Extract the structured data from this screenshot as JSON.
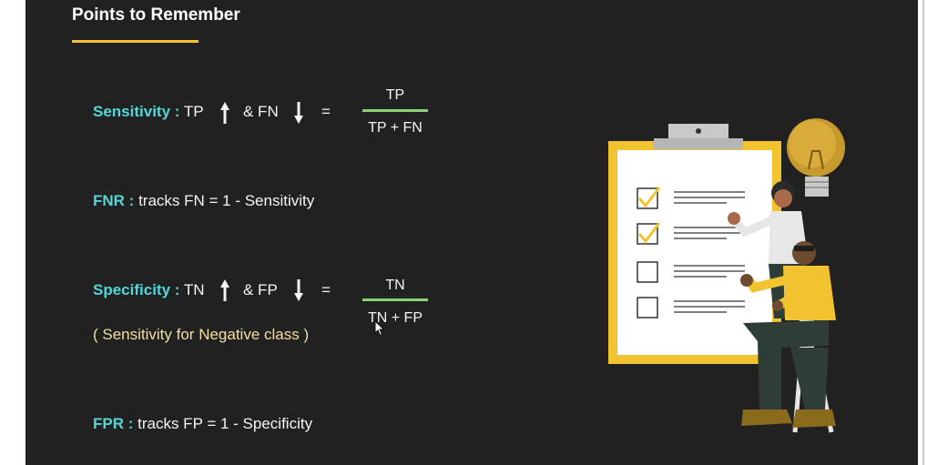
{
  "title": "Points to Remember",
  "colors": {
    "accent_yellow": "#f2c230",
    "term_cyan": "#52d6d6",
    "fraction_bar_green": "#8bd17a",
    "note_cream": "#f1df9b",
    "background": "#212121"
  },
  "sensitivity": {
    "term": "Sensitivity :",
    "part1": "TP",
    "part2": "& FN",
    "equals": "=",
    "numerator": "TP",
    "denominator": "TP + FN"
  },
  "fnr": {
    "term": "FNR :",
    "text": "tracks FN = 1 - Sensitivity"
  },
  "specificity": {
    "term": "Specificity :",
    "part1": "TN",
    "part2": "& FP",
    "equals": "=",
    "numerator": "TN",
    "denominator": "TN + FP",
    "note": "( Sensitivity for Negative class )"
  },
  "fpr": {
    "term": "FPR :",
    "text": "tracks FP = 1 - Specificity"
  },
  "icons": {
    "up": "arrow-up-icon",
    "down": "arrow-down-icon",
    "cursor": "mouse-cursor-icon",
    "illustration": "clipboard-checklist-people-illustration"
  }
}
